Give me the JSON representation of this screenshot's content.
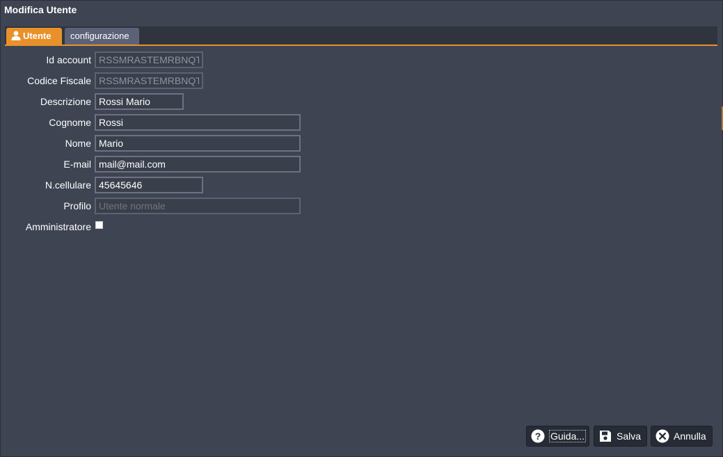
{
  "window": {
    "title": "Modifica Utente"
  },
  "tabs": [
    {
      "label": "Utente",
      "icon": "user-icon",
      "active": true
    },
    {
      "label": "configurazione",
      "active": false
    }
  ],
  "form": {
    "id_account": {
      "label": "Id account",
      "value": "RSSMRASTEMRBNQTN"
    },
    "codice_fiscale": {
      "label": "Codice Fiscale",
      "value": "RSSMRASTEMRBNQTN"
    },
    "descrizione": {
      "label": "Descrizione",
      "value": "Rossi Mario"
    },
    "cognome": {
      "label": "Cognome",
      "value": "Rossi"
    },
    "nome": {
      "label": "Nome",
      "value": "Mario"
    },
    "email": {
      "label": "E-mail",
      "value": "mail@mail.com"
    },
    "cellulare": {
      "label": "N.cellulare",
      "value": "45645646"
    },
    "profilo": {
      "label": "Profilo",
      "placeholder": "Utente normale"
    },
    "amministratore": {
      "label": "Amministratore",
      "checked": false
    }
  },
  "buttons": {
    "help": {
      "label": "Guida...",
      "icon": "help-icon"
    },
    "save": {
      "label": "Salva",
      "icon": "floppy-disk-icon"
    },
    "cancel": {
      "label": "Annulla",
      "icon": "close-circle-icon"
    }
  },
  "colors": {
    "accent": "#e8912b",
    "background": "#3e4452",
    "tab_inactive": "#5b6278"
  }
}
